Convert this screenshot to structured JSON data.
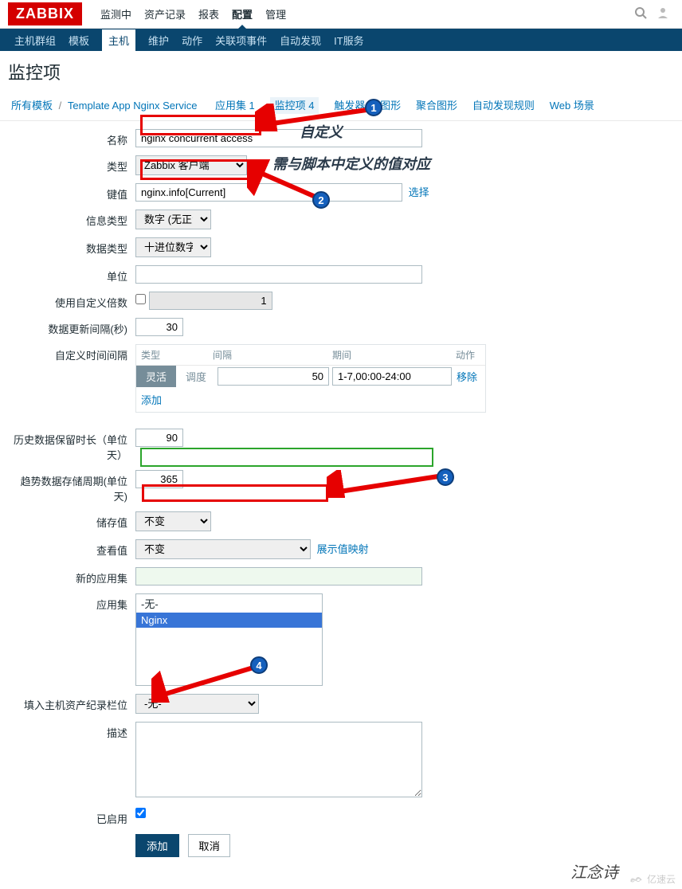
{
  "logo": "ZABBIX",
  "topnav": {
    "items": [
      "监测中",
      "资产记录",
      "报表",
      "配置",
      "管理"
    ],
    "active_index": 3
  },
  "subnav": {
    "items": [
      "主机群组",
      "模板",
      "主机",
      "维护",
      "动作",
      "关联项事件",
      "自动发现",
      "IT服务"
    ],
    "active_index": 2
  },
  "page_title": "监控项",
  "breadcrumb": {
    "all_templates": "所有模板",
    "template_name": "Template App Nginx Service",
    "apps": "应用集 1",
    "items": "监控项 4",
    "triggers": "触发器",
    "graphs": "图形",
    "aggregate": "聚合图形",
    "discovery": "自动发现规则",
    "web": "Web 场景"
  },
  "form": {
    "name": {
      "label": "名称",
      "value": "nginx concurrent access"
    },
    "type": {
      "label": "类型",
      "value": "Zabbix 客户端"
    },
    "key": {
      "label": "键值",
      "value": "nginx.info[Current]",
      "select_btn": "选择"
    },
    "info_type": {
      "label": "信息类型",
      "value": "数字 (无正负)"
    },
    "data_type": {
      "label": "数据类型",
      "value": "十进位数字"
    },
    "unit": {
      "label": "单位",
      "value": ""
    },
    "multiplier": {
      "label": "使用自定义倍数",
      "value": "1"
    },
    "interval": {
      "label": "数据更新间隔(秒)",
      "value": "30"
    },
    "custom_interval": {
      "label": "自定义时间间隔",
      "col_type": "类型",
      "col_interval": "间隔",
      "col_period": "期间",
      "col_action": "动作",
      "tab_flexible": "灵活",
      "tab_scheduling": "调度",
      "interval_value": "50",
      "period_value": "1-7,00:00-24:00",
      "action_remove": "移除",
      "add_link": "添加"
    },
    "history": {
      "label": "历史数据保留时长（单位天）",
      "value": "90"
    },
    "trends": {
      "label": "趋势数据存储周期(单位天)",
      "value": "365"
    },
    "store": {
      "label": "储存值",
      "value": "不变"
    },
    "show": {
      "label": "查看值",
      "value": "不变",
      "mapping_link": "展示值映射"
    },
    "new_app": {
      "label": "新的应用集",
      "value": ""
    },
    "apps": {
      "label": "应用集",
      "options": [
        "-无-",
        "Nginx"
      ],
      "selected_index": 1
    },
    "inventory": {
      "label": "填入主机资产纪录栏位",
      "value": "-无-"
    },
    "desc": {
      "label": "描述",
      "value": ""
    },
    "enabled": {
      "label": "已启用",
      "checked": true
    },
    "btn_add": "添加",
    "btn_cancel": "取消"
  },
  "annotations": {
    "text1": "自定义",
    "text2": "需与脚本中定义的值对应",
    "sig": "江念诗"
  },
  "watermark": "亿速云"
}
